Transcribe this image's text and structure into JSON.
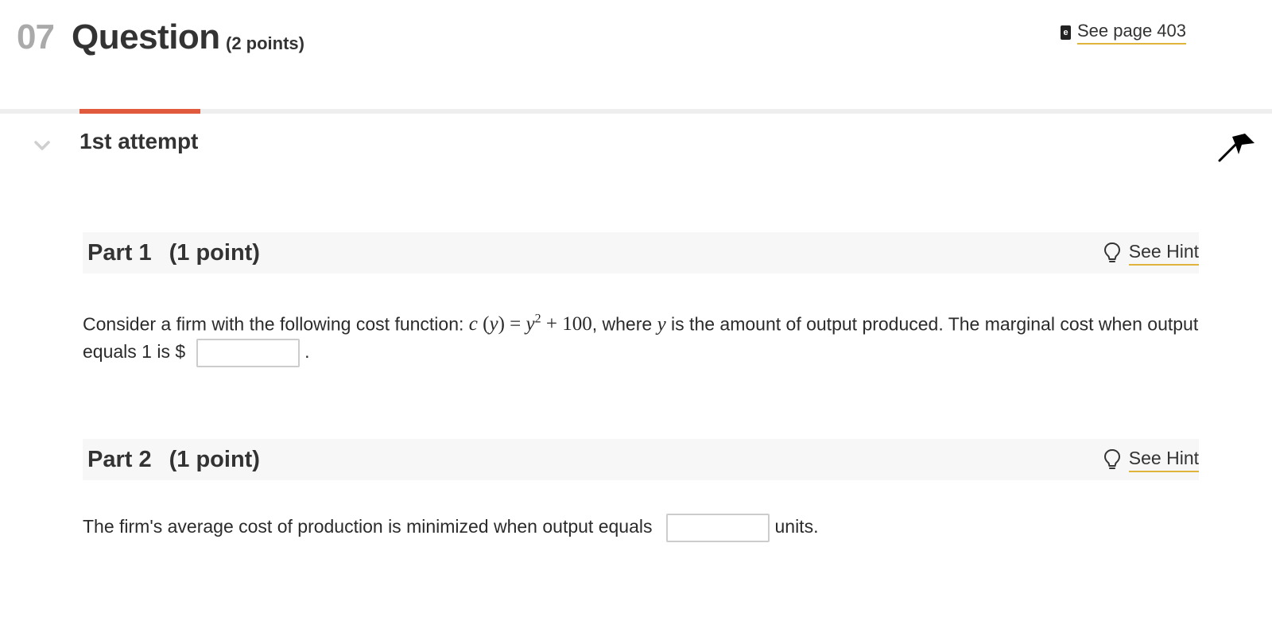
{
  "question": {
    "number": "07",
    "title": "Question",
    "points": "(2 points)"
  },
  "ebook": {
    "icon": "ebook-icon",
    "icon_glyph": "e",
    "link": "See page 403"
  },
  "attempt": {
    "label": "1st attempt",
    "accent_color": "#e05a3d"
  },
  "parts": [
    {
      "title": "Part 1",
      "points": "(1 point)",
      "hint": "See Hint",
      "text_before_math": "Consider a firm with the following cost function: ",
      "math_function": "c",
      "math_var": "y",
      "math_rhs_base": "y",
      "math_exponent": "2",
      "math_rhs_rest": " + 100",
      "text_after_math": ", where ",
      "math_var2": "y",
      "text_end": " is the amount of output produced. The marginal cost when output equals 1 is $",
      "answer_value": "",
      "text_after_box": "."
    },
    {
      "title": "Part 2",
      "points": "(1 point)",
      "hint": "See Hint",
      "text": "The firm's average cost of production is minimized when output equals",
      "answer_value": "",
      "unit": "units."
    }
  ],
  "colors": {
    "link_underline": "#e0b43a",
    "part_header_bg": "#f7f7f7"
  }
}
